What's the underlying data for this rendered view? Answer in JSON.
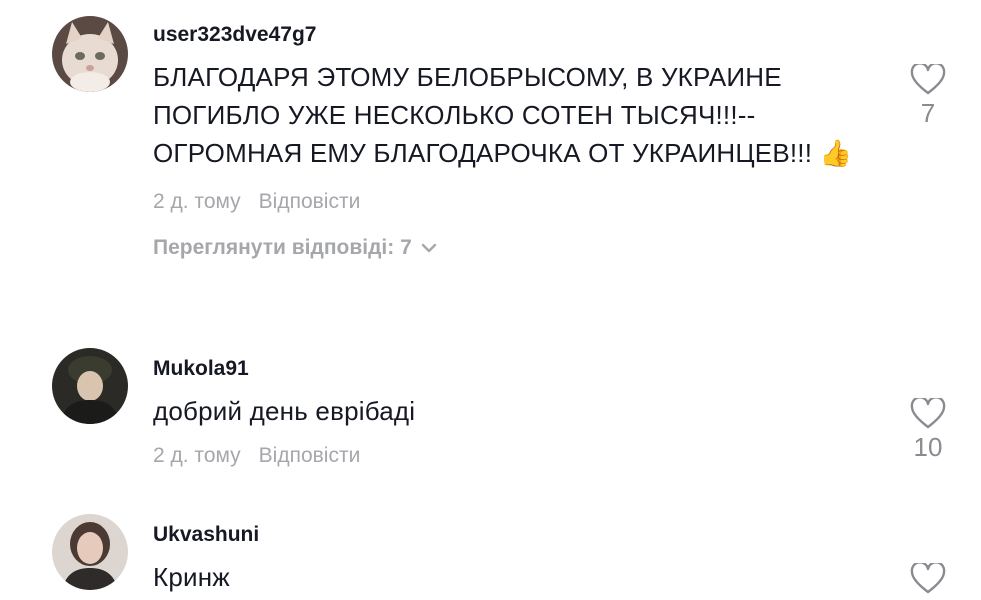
{
  "comments": [
    {
      "username": "user323dve47g7",
      "text": "БЛАГОДАРЯ ЭТОМУ БЕЛОБРЫСОМУ, В УКРАИНЕ ПОГИБЛО УЖЕ НЕСКОЛЬКО СОТЕН ТЫСЯЧ!!!-- ОГРОМНАЯ ЕМУ БЛАГОДАРОЧКА ОТ УКРАИНЦЕВ!!! 👍",
      "time": "2 д. тому",
      "reply_label": "Відповісти",
      "view_replies": "Переглянути відповіді: 7",
      "likes": "7",
      "avatar_icon": "cat-avatar"
    },
    {
      "username": "Mukola91",
      "text": "добрий день еврібаді",
      "time": "2 д. тому",
      "reply_label": "Відповісти",
      "likes": "10",
      "avatar_icon": "person-avatar"
    },
    {
      "username": "Ukvashuni",
      "text": "Кринж",
      "avatar_icon": "person-avatar"
    }
  ],
  "colors": {
    "text": "#161823",
    "muted": "#a6a7ab",
    "icon": "#8a8b91"
  }
}
